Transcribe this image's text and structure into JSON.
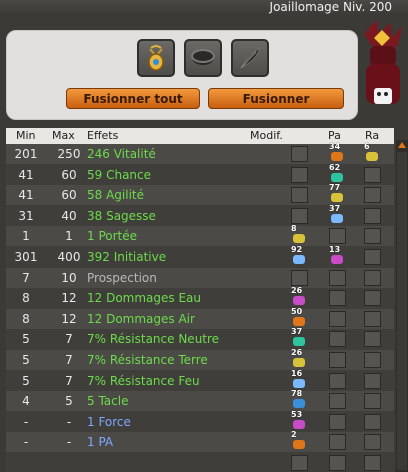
{
  "window": {
    "title": "Joaillomage Niv. 200"
  },
  "actions": {
    "merge_all": "Fusionner tout",
    "merge": "Fusionner"
  },
  "slots": [
    {
      "icon": "amulet-icon"
    },
    {
      "icon": "belt-icon"
    },
    {
      "icon": "feather-icon"
    }
  ],
  "table": {
    "headers": {
      "min": "Min",
      "max": "Max",
      "effects": "Effets",
      "modif": "Modif.",
      "pa": "Pa",
      "ra": "Ra"
    },
    "rows": [
      {
        "min": "201",
        "max": "250",
        "effect": "246 Vitalité",
        "color": "green",
        "modif": "",
        "pa": "34",
        "ra": "6"
      },
      {
        "min": "41",
        "max": "60",
        "effect": "59 Chance",
        "color": "green",
        "modif": "",
        "pa": "62",
        "ra": ""
      },
      {
        "min": "41",
        "max": "60",
        "effect": "58 Agilité",
        "color": "green",
        "modif": "",
        "pa": "77",
        "ra": ""
      },
      {
        "min": "31",
        "max": "40",
        "effect": "38 Sagesse",
        "color": "green",
        "modif": "",
        "pa": "37",
        "ra": ""
      },
      {
        "min": "1",
        "max": "1",
        "effect": "1 Portée",
        "color": "green",
        "modif": "8",
        "pa": "",
        "ra": ""
      },
      {
        "min": "301",
        "max": "400",
        "effect": "392 Initiative",
        "color": "green",
        "modif": "92",
        "pa": "13",
        "ra": ""
      },
      {
        "min": "7",
        "max": "10",
        "effect": "Prospection",
        "color": "grey",
        "modif": "",
        "pa": "",
        "ra": ""
      },
      {
        "min": "8",
        "max": "12",
        "effect": "12 Dommages Eau",
        "color": "green",
        "modif": "26",
        "pa": "",
        "ra": ""
      },
      {
        "min": "8",
        "max": "12",
        "effect": "12 Dommages Air",
        "color": "green",
        "modif": "50",
        "pa": "",
        "ra": ""
      },
      {
        "min": "5",
        "max": "7",
        "effect": "7% Résistance Neutre",
        "color": "green",
        "modif": "37",
        "pa": "",
        "ra": ""
      },
      {
        "min": "5",
        "max": "7",
        "effect": "7% Résistance Terre",
        "color": "green",
        "modif": "26",
        "pa": "",
        "ra": ""
      },
      {
        "min": "5",
        "max": "7",
        "effect": "7% Résistance Feu",
        "color": "green",
        "modif": "16",
        "pa": "",
        "ra": ""
      },
      {
        "min": "4",
        "max": "5",
        "effect": "5 Tacle",
        "color": "green",
        "modif": "78",
        "pa": "",
        "ra": ""
      },
      {
        "min": "-",
        "max": "-",
        "effect": "1 Force",
        "color": "blue",
        "modif": "53",
        "pa": "",
        "ra": ""
      },
      {
        "min": "-",
        "max": "-",
        "effect": "1 PA",
        "color": "blue",
        "modif": "2",
        "pa": "",
        "ra": ""
      },
      {
        "min": "",
        "max": "",
        "effect": "",
        "color": "green",
        "modif": "",
        "pa": "",
        "ra": ""
      }
    ]
  },
  "colors": {
    "accent": "#e0761a",
    "green": "#6cdb4a",
    "blue": "#7ea7ff",
    "grey": "#b8b8b8"
  }
}
